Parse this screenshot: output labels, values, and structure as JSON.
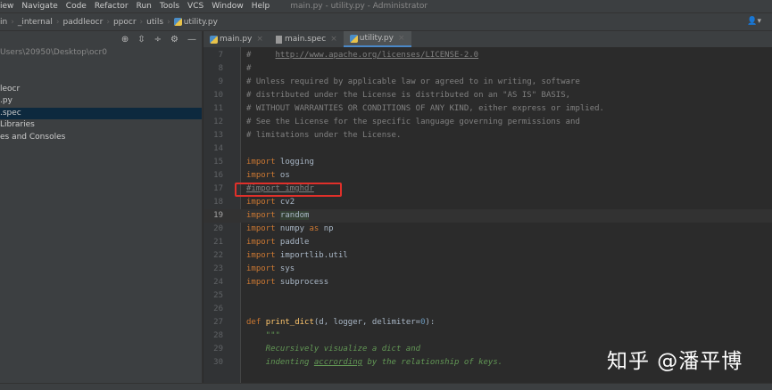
{
  "menu": [
    "iew",
    "Navigate",
    "Code",
    "Refactor",
    "Run",
    "Tools",
    "VCS",
    "Window",
    "Help"
  ],
  "window_title": "main.py - utility.py - Administrator",
  "breadcrumb": [
    "in",
    "_internal",
    "paddleocr",
    "ppocr",
    "utils",
    "utility.py"
  ],
  "sidebar": {
    "items": [
      {
        "label": "Users\\20950\\Desktop\\ocr0",
        "type": "path"
      },
      {
        "label": ""
      },
      {
        "label": ""
      },
      {
        "label": "leocr"
      },
      {
        "label": ".py"
      },
      {
        "label": ".spec",
        "selected": true
      },
      {
        "label": "Libraries"
      },
      {
        "label": "es and Consoles"
      }
    ]
  },
  "tabs": [
    {
      "label": "main.py",
      "icon": "python"
    },
    {
      "label": "main.spec",
      "icon": "file"
    },
    {
      "label": "utility.py",
      "icon": "python",
      "active": true
    }
  ],
  "close_glyph": "×",
  "code": {
    "l7": "7",
    "l8": "8",
    "l9": "9",
    "l10": "10",
    "l11": "11",
    "l12": "12",
    "l13": "13",
    "l14": "14",
    "l15": "15",
    "l16": "16",
    "l17": "17",
    "l18": "18",
    "l19": "19",
    "l20": "20",
    "l21": "21",
    "l22": "22",
    "l23": "23",
    "l24": "24",
    "l25": "25",
    "l26": "26",
    "l27": "27",
    "l28": "28",
    "l29": "29",
    "l30": "30",
    "hash": "#",
    "url_pre": "#     ",
    "url": "http://www.apache.org/licenses/LICENSE-2.0",
    "c9": "# Unless required by applicable law or agreed to in writing, software",
    "c10": "# distributed under the License is distributed on an \"AS IS\" BASIS,",
    "c11": "# WITHOUT WARRANTIES OR CONDITIONS OF ANY KIND, either express or implied.",
    "c12": "# See the License for the specific language governing permissions and",
    "c13": "# limitations under the License.",
    "import": "import",
    "as": "as",
    "m15": " logging",
    "m16": " os",
    "c17": "#import imghdr",
    "m18": " cv2",
    "m19": "random",
    "m20a": " numpy ",
    "m20b": " np",
    "m21": " paddle",
    "m22": " importlib.util",
    "m23": " sys",
    "m24": " subprocess",
    "def": "def",
    "fn": "print_dict",
    "args": "(d, logger, delimiter=",
    "zero": "0",
    "close": "):",
    "doc": "    \"\"\"",
    "d29": "    Recursively visualize a dict and",
    "d30a": "    indenting ",
    "d30b": "accrording",
    "d30c": " by the relationship of keys."
  },
  "watermark": "知乎 @潘平博"
}
